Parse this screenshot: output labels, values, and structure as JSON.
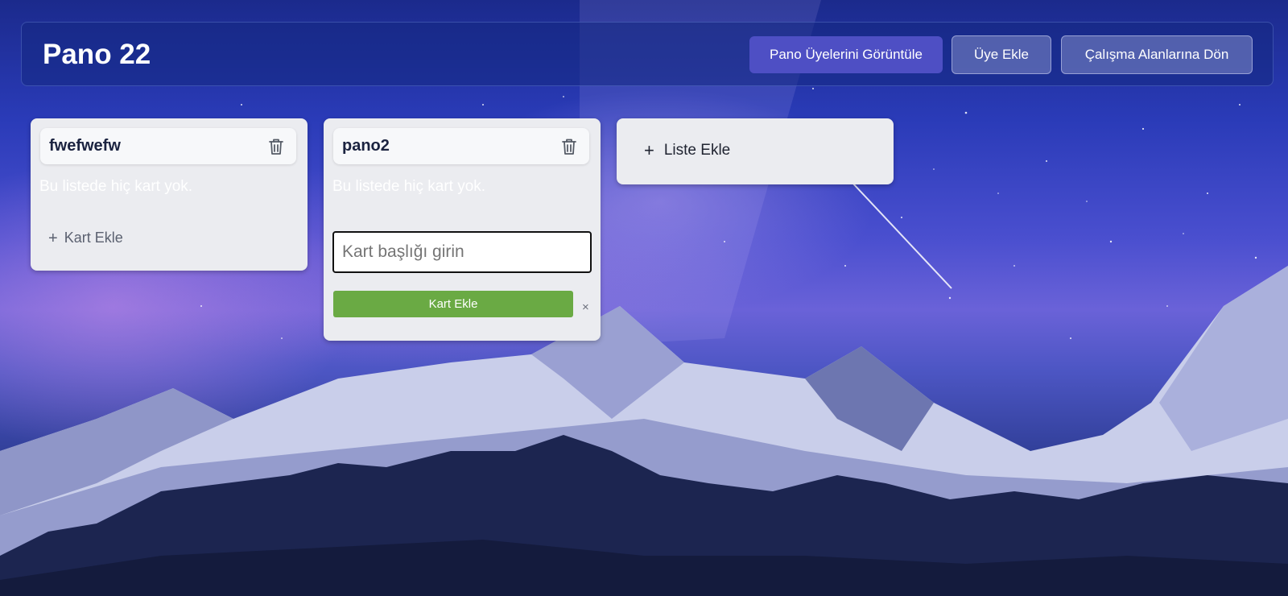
{
  "header": {
    "board_title": "Pano 22",
    "view_members_label": "Pano Üyelerini Görüntüle",
    "add_member_label": "Üye Ekle",
    "back_to_workspaces_label": "Çalışma Alanlarına Dön"
  },
  "lists": [
    {
      "title": "fwefwefw",
      "empty_text": "Bu listede hiç kart yok.",
      "add_card_label": "Kart Ekle"
    },
    {
      "title": "pano2",
      "empty_text": "Bu listede hiç kart yok.",
      "card_input_placeholder": "Kart başlığı girin",
      "add_card_submit_label": "Kart Ekle",
      "close_glyph": "×"
    }
  ],
  "add_list": {
    "label": "Liste Ekle"
  },
  "icons": {
    "trash": "trash-icon",
    "plus": "plus-icon",
    "close": "close-icon"
  },
  "colors": {
    "primary_button": "#4e4fc4",
    "success_button": "#6aaa44",
    "list_background": "#ebecf0"
  }
}
